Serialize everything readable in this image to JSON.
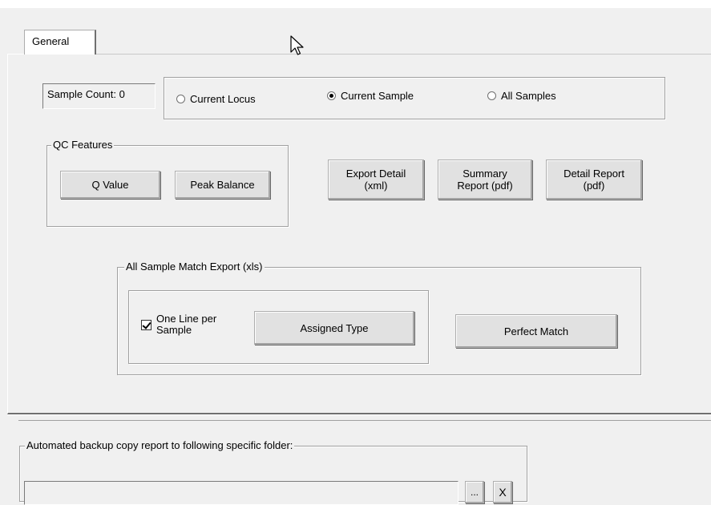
{
  "tabs": [
    {
      "label": "General",
      "selected": true
    }
  ],
  "sample_count": "Sample Count: 0",
  "scope_radios": [
    {
      "label": "Current Locus",
      "checked": false
    },
    {
      "label": "Current Sample",
      "checked": true
    },
    {
      "label": "All Samples",
      "checked": false
    }
  ],
  "qc": {
    "legend": "QC Features",
    "q_value_label": "Q Value",
    "peak_balance_label": "Peak Balance"
  },
  "reports": {
    "export_detail_label": "Export Detail (xml)",
    "summary_report_label": "Summary Report (pdf)",
    "detail_report_label": "Detail Report (pdf)"
  },
  "match_export": {
    "legend": "All Sample Match Export (xls)",
    "one_line_label": "One Line per Sample",
    "one_line_checked": true,
    "assigned_type_label": "Assigned Type",
    "perfect_match_label": "Perfect Match"
  },
  "backup": {
    "legend": "Automated backup copy report to following specific folder:",
    "folder_value": "",
    "browse_label": "...",
    "clear_label": "X"
  },
  "icons": {
    "cursor": "mouse-pointer-icon"
  }
}
